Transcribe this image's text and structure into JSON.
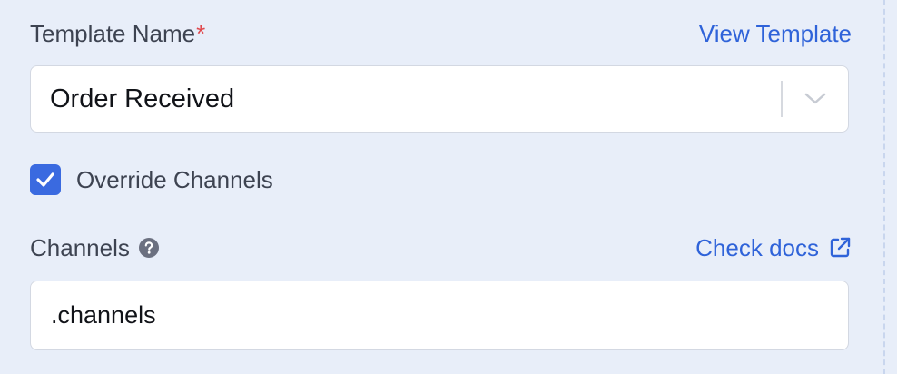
{
  "template_field": {
    "label": "Template Name",
    "required_marker": "*",
    "view_link": "View Template",
    "selected_value": "Order Received",
    "chevron_icon": "chevron-down-icon"
  },
  "override": {
    "label": "Override Channels",
    "checked": true,
    "check_icon": "check-icon"
  },
  "channels_field": {
    "label": "Channels",
    "help_icon": "question-circle-icon",
    "docs_link": "Check docs",
    "docs_icon": "external-link-icon",
    "value": ".channels"
  },
  "colors": {
    "background": "#e8eef9",
    "accent": "#3a6ae0",
    "link": "#2f63d9",
    "required": "#e0474c",
    "label": "#3d4351"
  }
}
